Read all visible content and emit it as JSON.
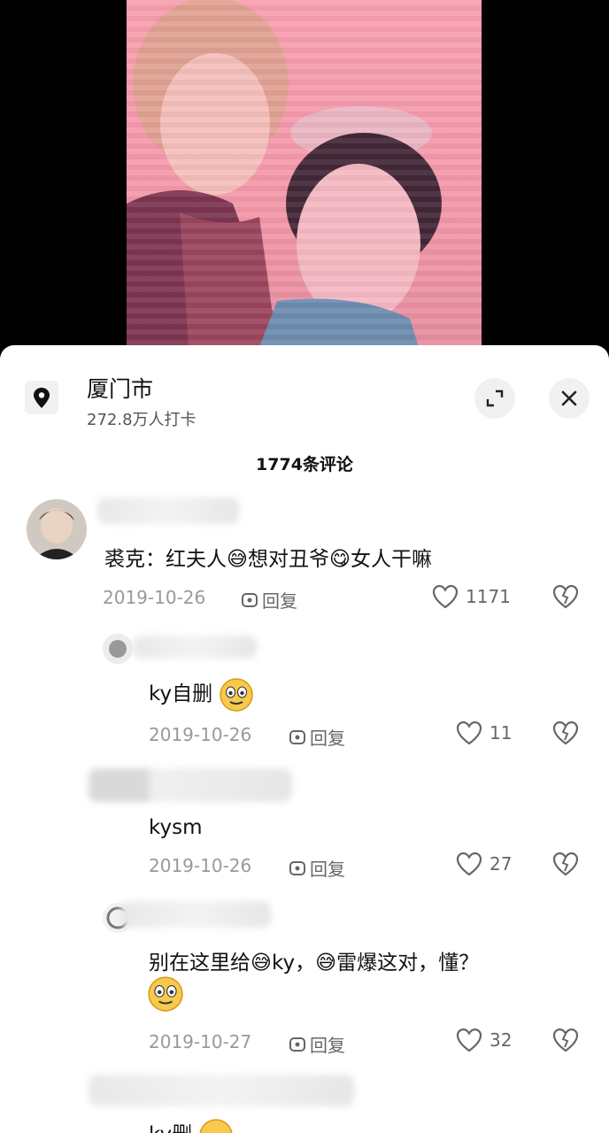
{
  "location": {
    "name": "厦门市",
    "checkins": "272.8万人打卡"
  },
  "comments_count": "1774条评论",
  "comments": [
    {
      "text": "裘克：红夫人😅想对丑爷😋女人干嘛",
      "date": "2019-10-26",
      "reply": "回复",
      "likes": "1171"
    },
    {
      "text": "ky自删",
      "date": "2019-10-26",
      "reply": "回复",
      "likes": "11"
    },
    {
      "text": "kysm",
      "date": "2019-10-26",
      "reply": "回复",
      "likes": "27"
    },
    {
      "text": "别在这里给😅ky，😅雷爆这对，懂？",
      "date": "2019-10-27",
      "reply": "回复",
      "likes": "32"
    },
    {
      "text": "ky删"
    }
  ],
  "icons": {
    "location": "location-pin-icon",
    "expand": "expand-icon",
    "close": "close-icon",
    "reply": "reply-icon",
    "like": "heart-icon",
    "dislike": "broken-heart-icon"
  }
}
